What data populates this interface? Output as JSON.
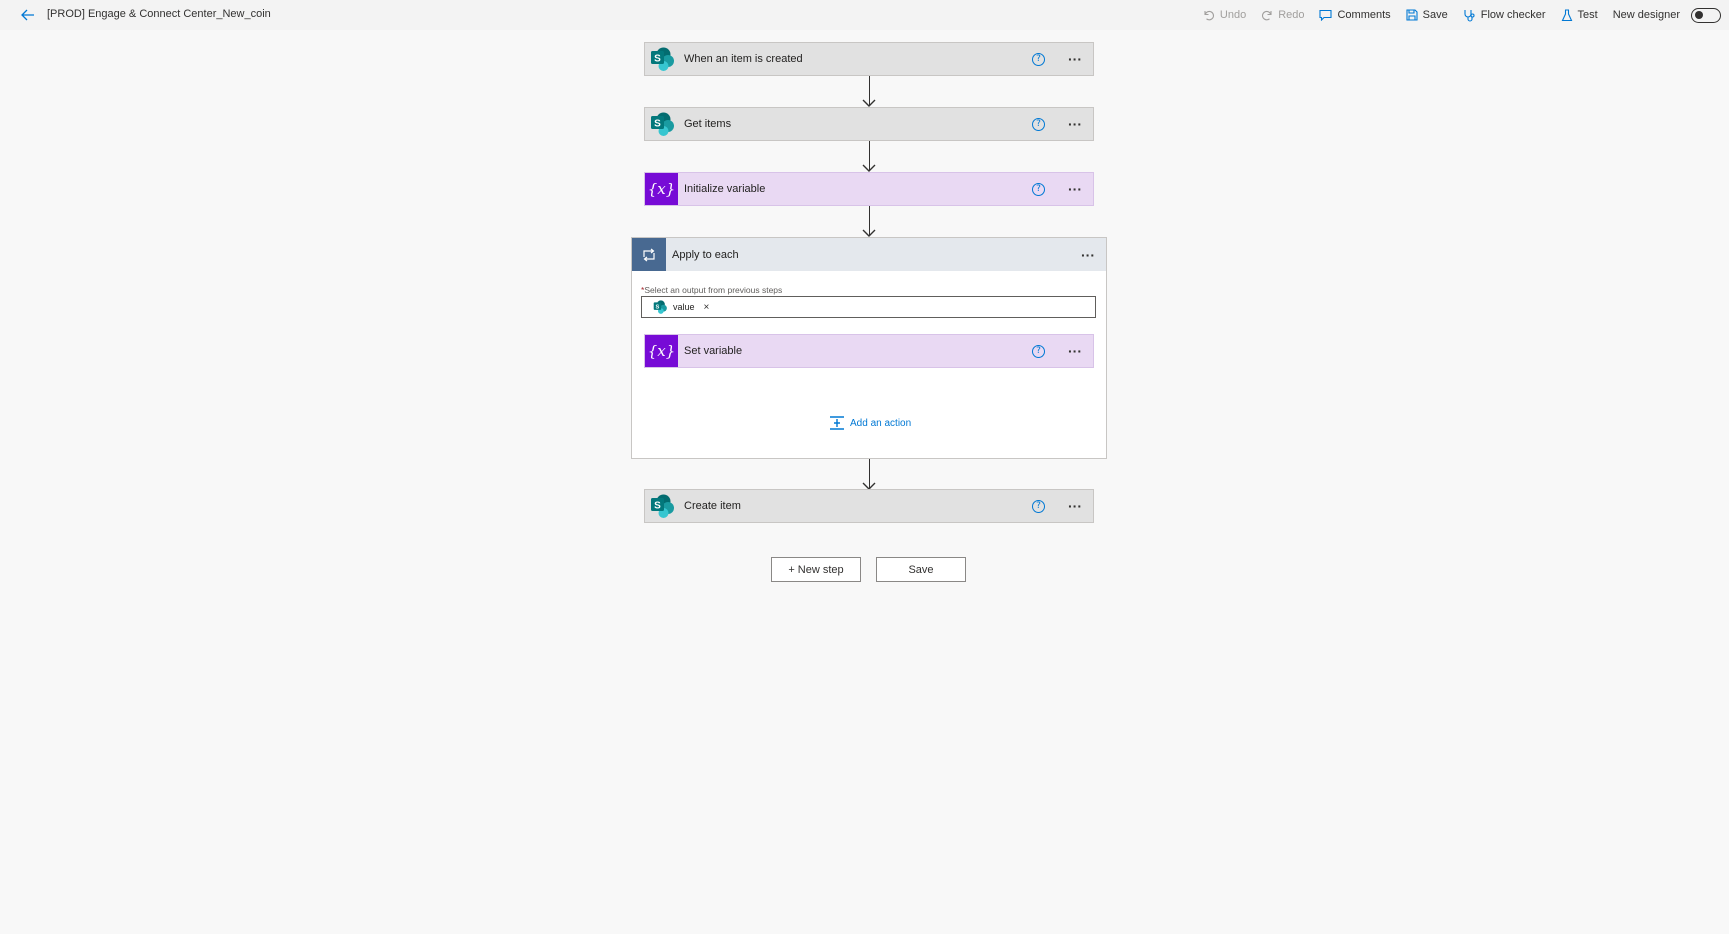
{
  "header": {
    "back_icon": "arrow-left-icon",
    "title": "[PROD] Engage & Connect Center_New_coin",
    "commands": {
      "undo": "Undo",
      "redo": "Redo",
      "comments": "Comments",
      "save": "Save",
      "flow_checker": "Flow checker",
      "test": "Test",
      "new_designer": "New designer"
    },
    "new_designer_on": false
  },
  "steps": {
    "trigger": {
      "name": "When an item is created",
      "connector": "sharepoint-icon"
    },
    "get_items": {
      "name": "Get items",
      "connector": "sharepoint-icon"
    },
    "init_variable": {
      "name": "Initialize variable",
      "connector": "variable-icon"
    },
    "apply_to_each": {
      "name": "Apply to each",
      "connector": "loop-icon",
      "field_required_mark": "*",
      "field_label": "Select an output from previous steps",
      "token": "value",
      "token_remove": "×",
      "inner": {
        "name": "Set variable",
        "connector": "variable-icon"
      },
      "add_action": "Add an action"
    },
    "create_item": {
      "name": "Create item",
      "connector": "sharepoint-icon"
    }
  },
  "help_glyph": "?",
  "more_glyph": "···",
  "footer": {
    "new_step": "+ New step",
    "save": "Save"
  },
  "colors": {
    "accent": "#0078d4",
    "variable": "#770bd6",
    "variable_card": "#e9d9f3",
    "loop": "#486991",
    "sharepoint": "#038387"
  }
}
